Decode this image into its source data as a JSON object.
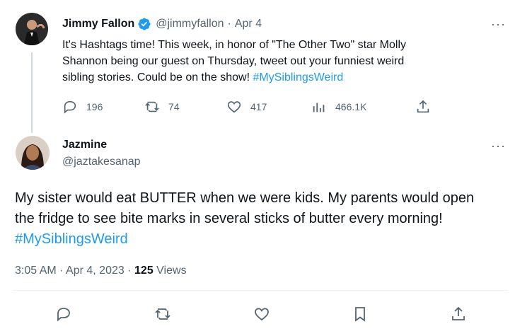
{
  "quoted_tweet": {
    "author_name": "Jimmy Fallon",
    "handle": "@jimmyfallon",
    "separator": "·",
    "date": "Apr 4",
    "text_line1": "It's Hashtags time! This week, in honor of \"The Other Two\" star Molly",
    "text_line2": "Shannon being our guest on Thursday, tweet out your funniest weird",
    "text_line3_plain": "sibling stories. Could be on the show! ",
    "text_line3_hashtag": "#MySiblingsWeird",
    "replies": "196",
    "retweets": "74",
    "likes": "417",
    "views": "466.1K",
    "more_label": "···"
  },
  "main_tweet": {
    "author_name": "Jazmine",
    "handle": "@jaztakesanap",
    "text_line1": "My sister would eat BUTTER when we were kids. My parents would open",
    "text_line2": "the fridge to see bite marks in several sticks of butter every morning!",
    "text_hashtag": "#MySiblingsWeird",
    "time": "3:05 AM",
    "separator1": "·",
    "date": "Apr 4, 2023",
    "separator2": "·",
    "views_count": "125",
    "views_label": "Views",
    "more_label": "···"
  },
  "colors": {
    "link": "#1d9bf0",
    "muted": "#536471",
    "verified": "#1d9bf0"
  },
  "icons": [
    "reply-icon",
    "retweet-icon",
    "like-icon",
    "views-icon",
    "share-icon",
    "bookmark-icon",
    "verified-badge-icon",
    "more-icon"
  ]
}
